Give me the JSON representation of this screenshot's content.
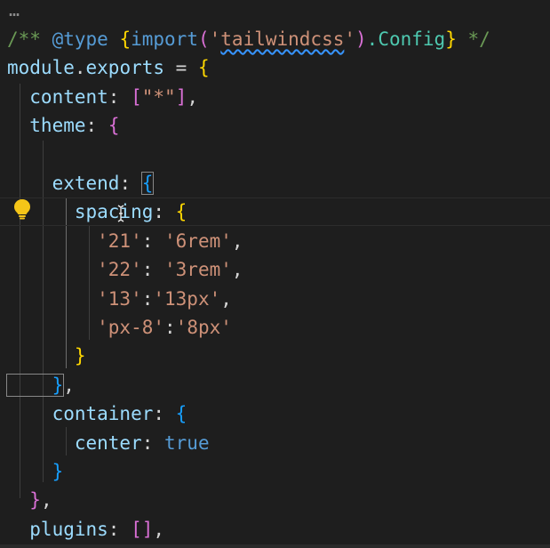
{
  "editor": {
    "fold_marker": "…",
    "lines": [
      {
        "tokens": [
          {
            "t": "/** ",
            "c": "c-comment"
          },
          {
            "t": "@type",
            "c": "c-keyword"
          },
          {
            "t": " ",
            "c": "c-comment"
          },
          {
            "t": "{",
            "c": "b1"
          },
          {
            "t": "import",
            "c": "c-keyword"
          },
          {
            "t": "(",
            "c": "b2"
          },
          {
            "t": "'",
            "c": "c-str"
          },
          {
            "t": "tailwindcss",
            "c": "c-str squiggle"
          },
          {
            "t": "'",
            "c": "c-str"
          },
          {
            "t": ")",
            "c": "b2"
          },
          {
            "t": ".Config",
            "c": "c-type"
          },
          {
            "t": "}",
            "c": "b1"
          },
          {
            "t": " */",
            "c": "c-comment"
          }
        ]
      },
      {
        "tokens": [
          {
            "t": "module",
            "c": "c-var"
          },
          {
            "t": ".",
            "c": "c-plain"
          },
          {
            "t": "exports",
            "c": "c-var"
          },
          {
            "t": " = ",
            "c": "c-plain"
          },
          {
            "t": "{",
            "c": "b1"
          }
        ]
      },
      {
        "tokens": [
          {
            "t": "  content",
            "c": "c-var"
          },
          {
            "t": ": ",
            "c": "c-plain"
          },
          {
            "t": "[",
            "c": "b2"
          },
          {
            "t": "\"*\"",
            "c": "c-str"
          },
          {
            "t": "]",
            "c": "b2"
          },
          {
            "t": ",",
            "c": "c-plain"
          }
        ]
      },
      {
        "tokens": [
          {
            "t": "  theme",
            "c": "c-var"
          },
          {
            "t": ": ",
            "c": "c-plain"
          },
          {
            "t": "{",
            "c": "b2"
          }
        ]
      },
      {
        "tokens": []
      },
      {
        "tokens": [
          {
            "t": "    extend",
            "c": "c-var"
          },
          {
            "t": ": ",
            "c": "c-plain"
          },
          {
            "t": "{",
            "c": "b3 bracket-match"
          }
        ]
      },
      {
        "tokens": [
          {
            "t": "      spacing",
            "c": "c-var"
          },
          {
            "t": ": ",
            "c": "c-plain"
          },
          {
            "t": "{",
            "c": "b1"
          }
        ]
      },
      {
        "tokens": [
          {
            "t": "        '21'",
            "c": "c-str"
          },
          {
            "t": ": ",
            "c": "c-plain"
          },
          {
            "t": "'6rem'",
            "c": "c-str"
          },
          {
            "t": ",",
            "c": "c-plain"
          }
        ]
      },
      {
        "tokens": [
          {
            "t": "        '22'",
            "c": "c-str"
          },
          {
            "t": ": ",
            "c": "c-plain"
          },
          {
            "t": "'3rem'",
            "c": "c-str"
          },
          {
            "t": ",",
            "c": "c-plain"
          }
        ]
      },
      {
        "tokens": [
          {
            "t": "        '13'",
            "c": "c-str"
          },
          {
            "t": ":",
            "c": "c-plain"
          },
          {
            "t": "'13px'",
            "c": "c-str"
          },
          {
            "t": ",",
            "c": "c-plain"
          }
        ]
      },
      {
        "tokens": [
          {
            "t": "        'px-8'",
            "c": "c-str"
          },
          {
            "t": ":",
            "c": "c-plain"
          },
          {
            "t": "'8px'",
            "c": "c-str"
          }
        ]
      },
      {
        "tokens": [
          {
            "t": "      }",
            "c": "b1"
          }
        ]
      },
      {
        "tokens": [
          {
            "t": "    }",
            "c": "b3 bracket-match"
          },
          {
            "t": ",",
            "c": "c-plain"
          }
        ]
      },
      {
        "tokens": [
          {
            "t": "    container",
            "c": "c-var"
          },
          {
            "t": ": ",
            "c": "c-plain"
          },
          {
            "t": "{",
            "c": "b3"
          }
        ]
      },
      {
        "tokens": [
          {
            "t": "      center",
            "c": "c-var"
          },
          {
            "t": ": ",
            "c": "c-plain"
          },
          {
            "t": "true",
            "c": "c-keyword"
          }
        ]
      },
      {
        "tokens": [
          {
            "t": "    }",
            "c": "b3"
          }
        ]
      },
      {
        "tokens": [
          {
            "t": "  }",
            "c": "b2"
          },
          {
            "t": ",",
            "c": "c-plain"
          }
        ]
      },
      {
        "tokens": [
          {
            "t": "  plugins",
            "c": "c-var"
          },
          {
            "t": ": ",
            "c": "c-plain"
          },
          {
            "t": "[",
            "c": "b2"
          },
          {
            "t": "]",
            "c": "b2"
          },
          {
            "t": ",",
            "c": "c-plain"
          }
        ]
      }
    ]
  },
  "icons": {
    "lightbulb": "lightbulb-icon",
    "text_cursor": "text-cursor-icon"
  },
  "colors": {
    "background": "#1e1e1e",
    "comment": "#6a9955",
    "keyword": "#569cd6",
    "property": "#9cdcfe",
    "string": "#ce9178",
    "bracket_gold": "#ffd700",
    "bracket_purple": "#da70d6",
    "bracket_blue": "#179fff",
    "lightbulb": "#f5c518"
  }
}
